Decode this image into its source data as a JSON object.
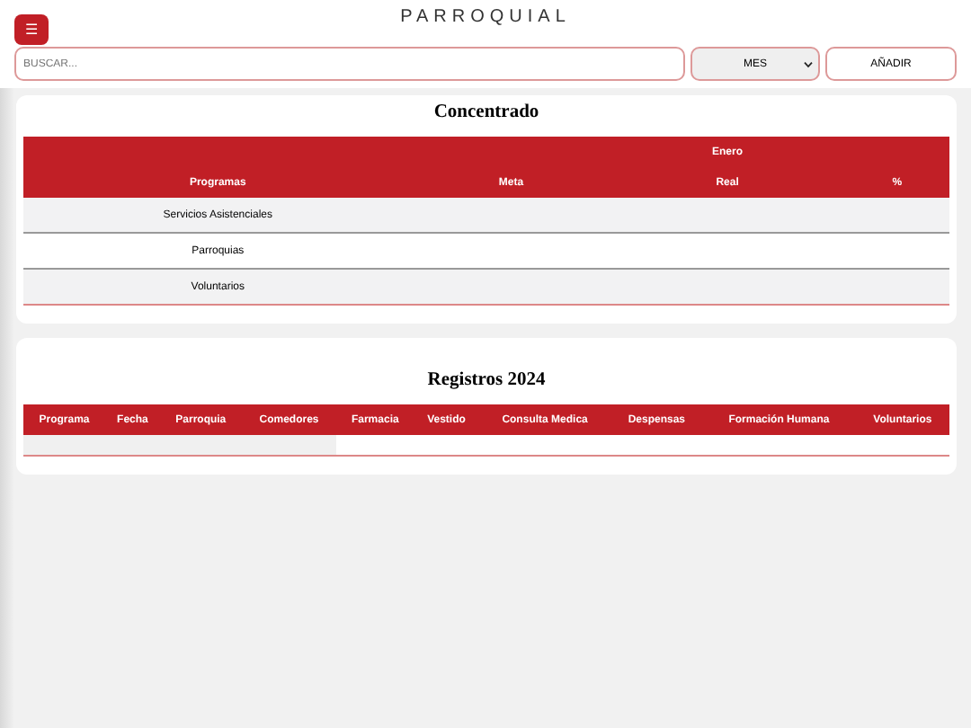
{
  "title": "PARROQUIAL",
  "menu_button": {
    "label": "☰"
  },
  "search": {
    "placeholder": "BUSCAR..."
  },
  "month_select": {
    "value": "MES"
  },
  "add_button": {
    "label": "AÑADIR"
  },
  "concentrado": {
    "title": "Concentrado",
    "group_header": "Enero",
    "columns": [
      "Programas",
      "Meta",
      "Real",
      "%"
    ],
    "rows": [
      [
        "Servicios Asistenciales"
      ],
      [
        "Parroquias"
      ],
      [
        "Voluntarios"
      ]
    ]
  },
  "registros": {
    "title": "Registros 2024",
    "columns": [
      "Programa",
      "Fecha",
      "Parroquia",
      "Comedores",
      "Farmacia",
      "Vestido",
      "Consulta Medica",
      "Despensas",
      "Formación Humana",
      "Voluntarios"
    ]
  }
}
